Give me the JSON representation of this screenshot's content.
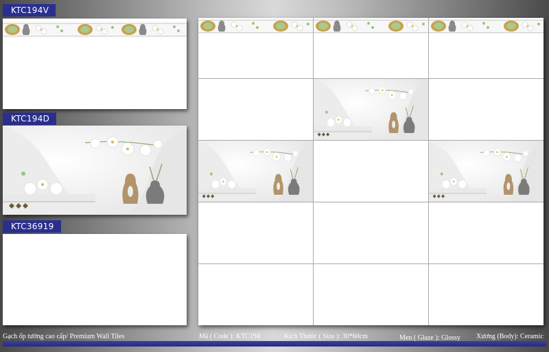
{
  "panels": {
    "v_label": "KTC194V",
    "d_label": "KTC194D",
    "plain_label": "KTC36919"
  },
  "footer": {
    "product_line": "Gạch ốp tường cao cấp/ Premium Wall Tiles",
    "code": "Mã ( Code ): KTC194",
    "size": "Kích Thước ( Size ): 30*60cm",
    "glaze": "Men ( Glaze ): Glossy",
    "body": "Xương (Body): Ceramic"
  },
  "colors": {
    "label_bg": "#2a2f8f",
    "bar": "#262a80"
  }
}
